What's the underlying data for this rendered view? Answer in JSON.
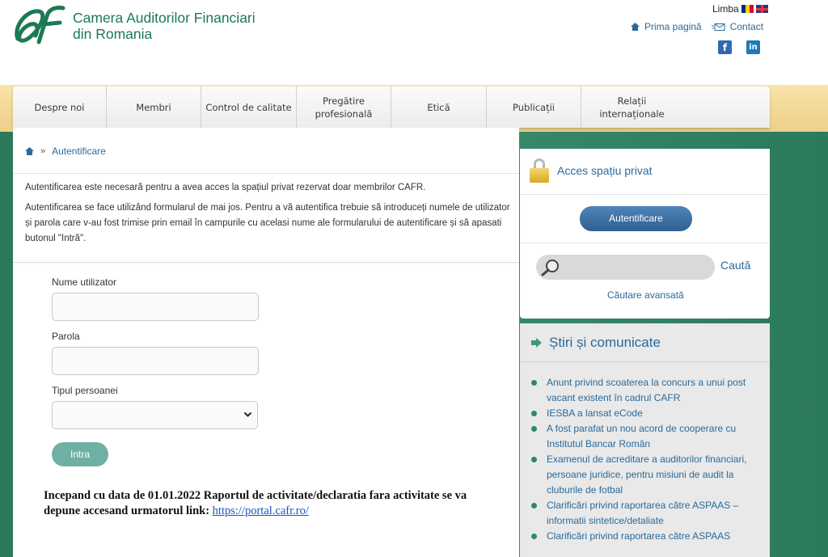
{
  "header": {
    "org_line1": "Camera Auditorilor Financiari",
    "org_line2": "din Romania",
    "language_label": "Limba",
    "home_link": "Prima pagină",
    "contact_link": "Contact",
    "facebook_glyph": "f",
    "linkedin_glyph": "in"
  },
  "nav": {
    "items": [
      {
        "label": "Despre noi"
      },
      {
        "label": "Membri"
      },
      {
        "label": "Control de calitate"
      },
      {
        "label": "Pregătire profesională"
      },
      {
        "label": "Etică"
      },
      {
        "label": "Publicații"
      },
      {
        "label": "Relații internaționale"
      }
    ]
  },
  "breadcrumb": {
    "separator": "»",
    "current": "Autentificare"
  },
  "intro": {
    "p1": "Autentificarea este necesară pentru a avea acces la spațiul privat rezervat doar membrilor CAFR.",
    "p2": "Autentificarea se face utilizând formularul de mai jos. Pentru a vă autentifica trebuie să introduceți numele de utilizator și parola care v-au fost trimise prin email în campurile cu acelasi nume ale formularului de autentificare și să apasati butonul \"Intră\"."
  },
  "form": {
    "username_label": "Nume utilizator",
    "username_value": "",
    "password_label": "Parola",
    "password_value": "",
    "person_type_label": "Tipul persoanei",
    "person_type_value": "",
    "submit_label": "Intra"
  },
  "notice": {
    "text": "Incepand cu data de 01.01.2022 Raportul de activitate/declaratia fara activitate se va depune accesand urmatorul link: ",
    "link": "https://portal.cafr.ro/"
  },
  "sidebar": {
    "private_title": "Acces spațiu privat",
    "auth_button": "Autentificare",
    "search_value": "",
    "search_button": "Caută",
    "advanced_search": "Căutare avansată",
    "news_title": "Știri și comunicate",
    "news": [
      "Anunt privind scoaterea la concurs a unui post vacant existent în cadrul CAFR",
      "IESBA a lansat eCode",
      "A fost parafat un nou acord de cooperare cu Institutul Bancar Român",
      "Examenul de acreditare a auditorilor financiari, persoane juridice, pentru misiuni de audit la cluburile de fotbal",
      "Clarificări privind raportarea către ASPAAS – informatii sintetice/detaliate",
      "Clarificări privind raportarea către ASPAAS"
    ]
  },
  "colors": {
    "brand_green": "#1c7a52",
    "link_blue": "#2a6a9a",
    "button_teal": "#6fb0a4",
    "auth_blue": "#2e5f8f"
  },
  "icons": [
    "home-icon",
    "envelope-icon",
    "facebook-icon",
    "linkedin-icon",
    "lock-icon",
    "search-icon",
    "arrow-right-icon",
    "chevron-down-icon"
  ]
}
